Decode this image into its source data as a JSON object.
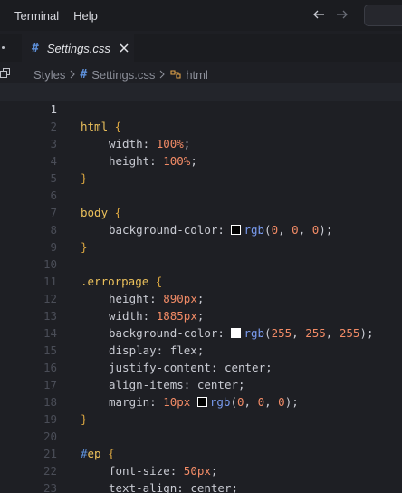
{
  "menubar": {
    "items": [
      "Terminal",
      "Help"
    ]
  },
  "tab": {
    "label": "Settings.css",
    "icon": "#"
  },
  "breadcrumb": {
    "items": [
      "Styles",
      "Settings.css",
      "html"
    ]
  },
  "editor": {
    "active_line": 1,
    "lines": [
      {
        "n": "1"
      },
      {
        "n": "2"
      },
      {
        "n": "3"
      },
      {
        "n": "4"
      },
      {
        "n": "5"
      },
      {
        "n": "6"
      },
      {
        "n": "7"
      },
      {
        "n": "8"
      },
      {
        "n": "9"
      },
      {
        "n": "10"
      },
      {
        "n": "11"
      },
      {
        "n": "12"
      },
      {
        "n": "13"
      },
      {
        "n": "14"
      },
      {
        "n": "15"
      },
      {
        "n": "16"
      },
      {
        "n": "17"
      },
      {
        "n": "18"
      },
      {
        "n": "19"
      },
      {
        "n": "20"
      },
      {
        "n": "21"
      },
      {
        "n": "22"
      },
      {
        "n": "23"
      }
    ],
    "code": {
      "l1_sel": "html",
      "l1_brace": " {",
      "l2_prop": "width: ",
      "l2_val": "100%",
      "l2_end": ";",
      "l3_prop": "height: ",
      "l3_val": "100%",
      "l3_end": ";",
      "l4_brace": "}",
      "l6_sel": "body",
      "l6_brace": " {",
      "l7_prop": "background-color: ",
      "l7_fn": "rgb",
      "l7_open": "(",
      "l7_a": "0",
      "l7_c1": ", ",
      "l7_b": "0",
      "l7_c2": ", ",
      "l7_c": "0",
      "l7_close": ");",
      "l8_brace": "}",
      "l10_sel": ".errorpage",
      "l10_brace": " {",
      "l11_prop": "height: ",
      "l11_val": "890px",
      "l11_end": ";",
      "l12_prop": "width: ",
      "l12_val": "1885px",
      "l12_end": ";",
      "l13_prop": "background-color: ",
      "l13_fn": "rgb",
      "l13_open": "(",
      "l13_a": "255",
      "l13_c1": ", ",
      "l13_b": "255",
      "l13_c2": ", ",
      "l13_c": "255",
      "l13_close": ");",
      "l14_prop": "display: ",
      "l14_val": "flex",
      "l14_end": ";",
      "l15_prop": "justify-content: ",
      "l15_val": "center",
      "l15_end": ";",
      "l16_prop": "align-items: ",
      "l16_val": "center",
      "l16_end": ";",
      "l17_prop": "margin: ",
      "l17_num": "10px",
      "l17_sp": " ",
      "l17_fn": "rgb",
      "l17_open": "(",
      "l17_a": "0",
      "l17_c1": ", ",
      "l17_b": "0",
      "l17_c2": ", ",
      "l17_c": "0",
      "l17_close": ");",
      "l18_brace": "}",
      "l20_hash": "#",
      "l20_sel": "ep",
      "l20_brace": " {",
      "l21_prop": "font-size: ",
      "l21_val": "50px",
      "l21_end": ";",
      "l22_prop": "text-align: ",
      "l22_val": "center",
      "l22_end": ";",
      "l23_brace": "}"
    },
    "swatches": {
      "black": "#000000",
      "white": "#ffffff"
    }
  },
  "colors": {
    "selector": "#ebc05b",
    "number": "#f28b66",
    "function": "#7a9cf0",
    "css_icon": "#5d8fd8"
  }
}
